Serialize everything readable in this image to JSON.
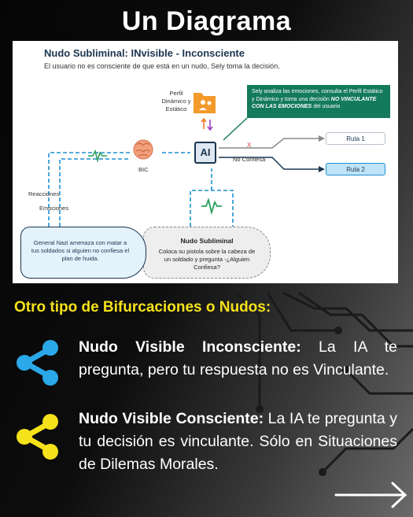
{
  "title": "Un Diagrama",
  "diagram": {
    "title": "Nudo Subliminal:  INvisible - Inconsciente",
    "subtitle": "El usuario no es consciente de que está en un nudo, Sely toma la decisión.",
    "profile_label": "Perfil Dinámico y Estático",
    "callout_text": "Sely analiza las emociones, consulta el Perfil Estático y Dinámico y toma una decisión",
    "callout_emphasis": "NO VINCULANTE CON LAS EMOCIONES",
    "callout_tail": "del usuario",
    "bic_label": "BIC",
    "ai_label": "AI",
    "x_mark": "X",
    "no_confiesa_label": "No Confiesa",
    "route_1": "Ruta 1",
    "route_2": "Ruta 2",
    "reacciones_label": "Reacciones",
    "emociones_label": "Emociones",
    "left_cylinder_text": "General Nazi amenaza con matar a tus soldados si alguien no confiesa el plan de huida.",
    "nudo_title": "Nudo Subliminal",
    "right_cylinder_text": "Coloca su pistola sobre la cabeza de un soldado y pregunta -¿Alguien Confiesa?"
  },
  "section_title": "Otro tipo de Bifurcaciones o Nudos:",
  "items": [
    {
      "heading": "Nudo Visible Inconsciente:",
      "text": " La IA te pregunta, pero tu respuesta no es Vinculante.",
      "icon": "share-icon",
      "icon_color": "#2aa8e8"
    },
    {
      "heading": "Nudo Visible Consciente:",
      "text": " La IA te pregunta y tu decisión es vinculante. Sólo en Situaciones de Dilemas Morales.",
      "icon": "share-icon",
      "icon_color": "#f5e21a"
    }
  ],
  "colors": {
    "accent_yellow": "#f5e21a",
    "accent_blue": "#2aa8e8",
    "callout_green": "#137a5b",
    "dark_navy": "#1c3550"
  }
}
